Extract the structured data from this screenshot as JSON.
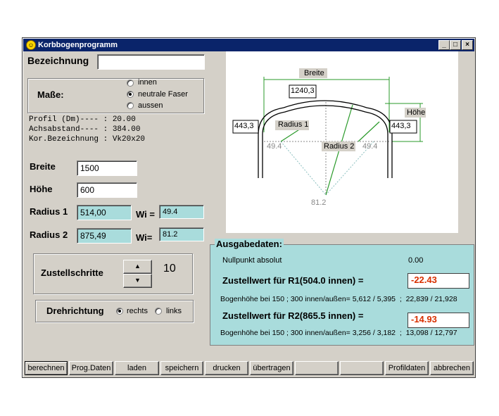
{
  "window": {
    "title": "Korbbogenprogramm",
    "minimize": "_",
    "maximize": "□",
    "close": "×"
  },
  "bezeichnung": {
    "label": "Bezeichnung",
    "value": ""
  },
  "masse": {
    "label": "Maße:",
    "options": [
      "innen",
      "neutrale Faser",
      "aussen"
    ],
    "selected": "neutrale Faser"
  },
  "profile": {
    "line1": "Profil (Dm)---- : 20.00",
    "line2": "Achsabstand---- : 384.00",
    "line3": "Kor.Bezeichnung : Vk20x20"
  },
  "breite": {
    "label": "Breite",
    "value": "1500"
  },
  "hoehe": {
    "label": "Höhe",
    "value": "600"
  },
  "radius1": {
    "label": "Radius 1",
    "value": "514,00",
    "wi_label": "Wi =",
    "wi_value": "49.4"
  },
  "radius2": {
    "label": "Radius 2",
    "value": "875,49",
    "wi_label": "Wi=",
    "wi_value": "81.2"
  },
  "zustellschritte": {
    "label": "Zustellschritte",
    "value": "10"
  },
  "drehrichtung": {
    "label": "Drehrichtung",
    "options": [
      "rechts",
      "links"
    ],
    "selected": "rechts"
  },
  "diagram": {
    "breite_label": "Breite",
    "breite_value": "1240,3",
    "hoehe_label": "Höhe",
    "left_value": "443,3",
    "right_value": "443,3",
    "radius1_label": "Radius 1",
    "radius2_label": "Radius 2",
    "angle_left": "49.4",
    "angle_right": "49.4",
    "angle_bottom": "81.2"
  },
  "ausgabe": {
    "legend": "Ausgabedaten:",
    "nullpunkt_label": "Nullpunkt absolut",
    "nullpunkt_value": "0.00",
    "r1_label": "Zustellwert für R1(504.0 innen) =",
    "r1_value": "-22.43",
    "r1_bogen": "Bogenhöhe bei 150 ; 300 innen/außen= 5,612 / 5,395  ;  22,839 / 21,928",
    "r2_label": "Zustellwert für R2(865.5 innen) =",
    "r2_value": "-14.93",
    "r2_bogen": "Bogenhöhe bei 150 ; 300 innen/außen= 3,256 / 3,182  ;  13,098 / 12,797"
  },
  "buttons": [
    "berechnen",
    "Prog.Daten",
    "laden",
    "speichern",
    "drucken",
    "übertragen",
    "",
    "",
    "Profildaten",
    "abbrechen"
  ]
}
